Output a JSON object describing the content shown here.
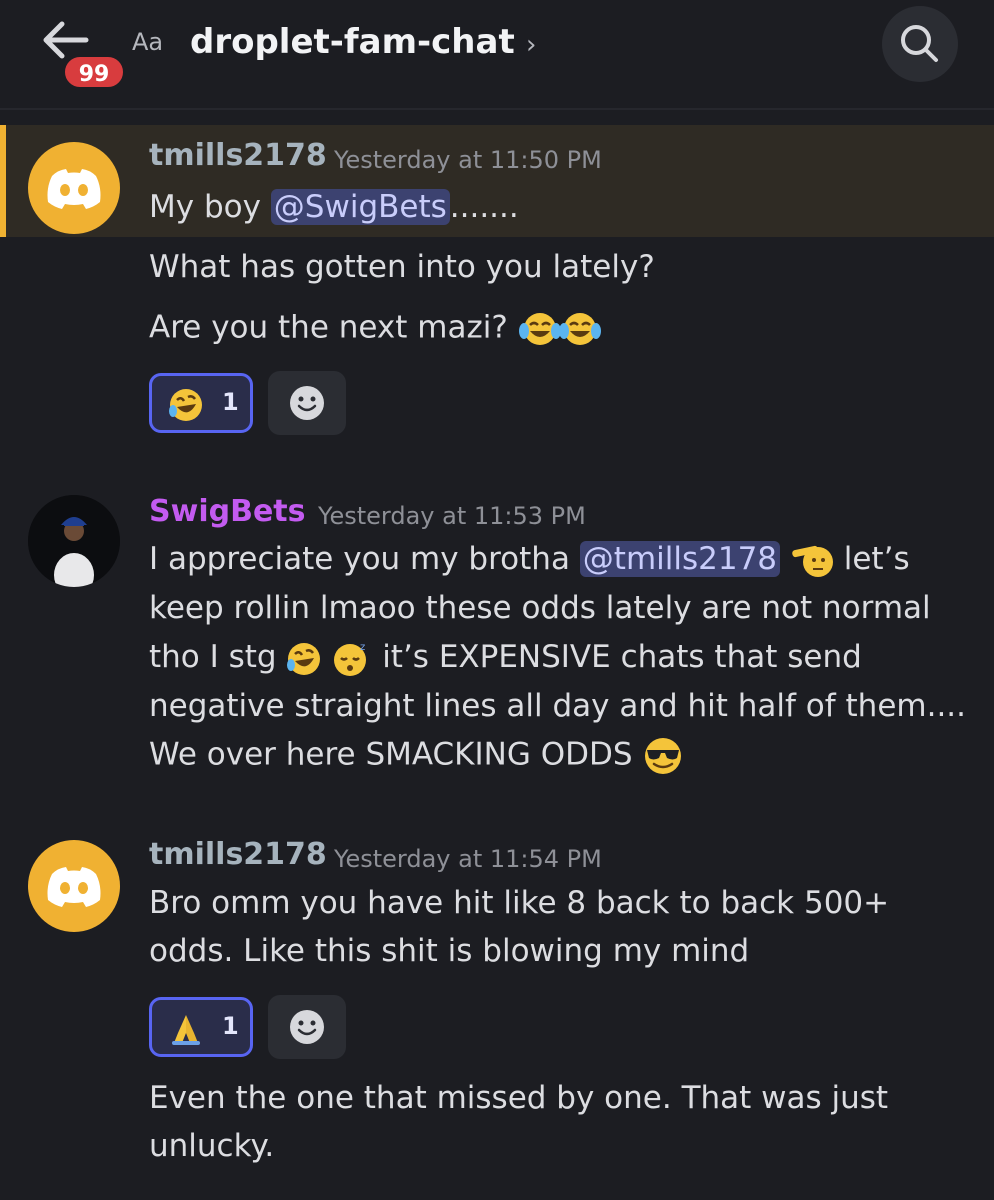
{
  "header": {
    "badge_count": "99",
    "font_toggle": "Aa",
    "channel_name": "droplet-fam-chat",
    "chevron": "›",
    "search_icon": "search-icon",
    "back_icon": "arrow-left-icon"
  },
  "messages": [
    {
      "author": "tmills2178",
      "timestamp": "Yesterday at 11:50 PM",
      "line1_pre": "My boy ",
      "line1_mention": "@SwigBets",
      "line1_post": ".......",
      "line2": "What has gotten into you lately?",
      "line3": "Are you the next mazi?",
      "reaction": {
        "emoji": "rolling-on-floor-laughing",
        "count": "1"
      }
    },
    {
      "author": "SwigBets",
      "timestamp": "Yesterday at 11:53 PM",
      "line1_pre": "I appreciate you my brotha ",
      "line1_mention": "@tmills2178",
      "line1_post": "let’s",
      "line2": "keep rollin lmaoo these odds lately are not normal",
      "line3_pre": "tho I stg ",
      "line3_post": " it’s EXPENSIVE chats that send",
      "line4": "negative straight lines all day and hit half of them....",
      "line5": "We over here SMACKING ODDS"
    },
    {
      "author": "tmills2178",
      "timestamp": "Yesterday at 11:54 PM",
      "line1": "Bro omm you have hit like 8 back to back 500+",
      "line2": "odds. Like this shit is blowing my mind",
      "reaction": {
        "emoji": "folded-hands",
        "count": "1"
      },
      "line3": "Even the one that missed by one. That was just",
      "line4": "unlucky."
    }
  ],
  "colors": {
    "background": "#1c1d22",
    "highlight": "#2f2b24",
    "highlight_bar": "#f0b232",
    "mention_bg": "#3c4270",
    "reaction_border": "#5865f2",
    "badge": "#d83c3e",
    "swigbets_name": "#c35bf0"
  }
}
